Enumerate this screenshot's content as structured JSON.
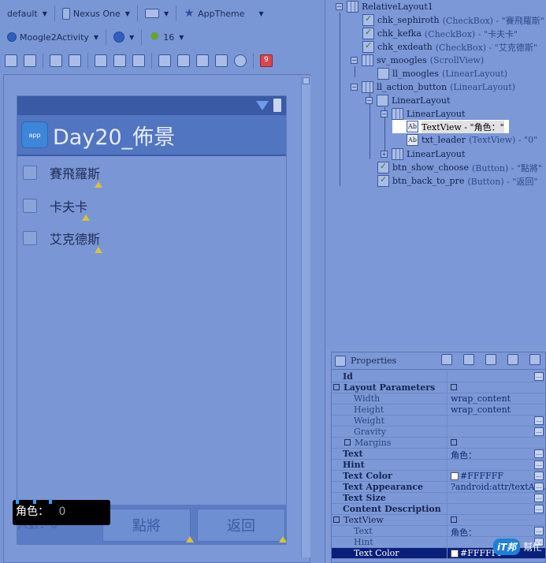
{
  "toolbar1": {
    "config": "default",
    "device": "Nexus One",
    "theme": "AppTheme"
  },
  "toolbar2": {
    "activity": "Moogle2Activity",
    "api_level": "16",
    "badge": "9"
  },
  "device": {
    "app_title": "Day20_佈景",
    "icon_text": "app",
    "checkboxes": [
      {
        "label": "賽飛羅斯"
      },
      {
        "label": "卡夫卡"
      },
      {
        "label": "艾克德斯"
      }
    ],
    "selected_text": "角色：",
    "selected_value": "0",
    "count_label": "人數：0",
    "buttons": {
      "ok": "點將",
      "back": "返回"
    }
  },
  "outline": {
    "nodes": [
      {
        "name": "RelativeLayout1",
        "kind": ""
      },
      {
        "name": "chk_sephiroth",
        "kind": "(CheckBox) - \"賽飛羅斯\""
      },
      {
        "name": "chk_kefka",
        "kind": "(CheckBox) - \"卡夫卡\""
      },
      {
        "name": "chk_exdeath",
        "kind": "(CheckBox) - \"艾克德斯\""
      },
      {
        "name": "sv_moogles",
        "kind": "(ScrollView)"
      },
      {
        "name": "ll_moogles",
        "kind": "(LinearLayout)"
      },
      {
        "name": "ll_action_button",
        "kind": "(LinearLayout)"
      },
      {
        "name": "LinearLayout",
        "kind": ""
      },
      {
        "name": "LinearLayout",
        "kind": ""
      },
      {
        "name": "TextView - \"角色：\"",
        "kind": ""
      },
      {
        "name": "txt_leader",
        "kind": "(TextView) - \"0\""
      },
      {
        "name": "LinearLayout",
        "kind": ""
      },
      {
        "name": "btn_show_choose",
        "kind": "(Button) - \"點將\""
      },
      {
        "name": "btn_back_to_pre",
        "kind": "(Button) - \"返回\""
      }
    ]
  },
  "properties": {
    "title": "Properties",
    "rows": [
      {
        "name": "Id",
        "value": ""
      },
      {
        "name": "Layout Parameters",
        "value": ""
      },
      {
        "name": "Width",
        "value": "wrap_content"
      },
      {
        "name": "Height",
        "value": "wrap_content"
      },
      {
        "name": "Weight",
        "value": ""
      },
      {
        "name": "Gravity",
        "value": ""
      },
      {
        "name": "Margins",
        "value": ""
      },
      {
        "name": "Text",
        "value": "角色："
      },
      {
        "name": "Hint",
        "value": ""
      },
      {
        "name": "Text Color",
        "value": "#FFFFFF"
      },
      {
        "name": "Text Appearance",
        "value": "?android:attr/textAp..."
      },
      {
        "name": "Text Size",
        "value": ""
      },
      {
        "name": "Content Description",
        "value": ""
      },
      {
        "name": "TextView",
        "value": ""
      },
      {
        "name": "Text",
        "value": "角色："
      },
      {
        "name": "Hint",
        "value": ""
      },
      {
        "name": "Text Color",
        "value": "#FFFFFF"
      }
    ]
  },
  "watermark": {
    "logo": "iT邦",
    "text": "幫忙"
  },
  "colors": {
    "accent_selection": "#0a1f7a",
    "actionbar": "#5275c2",
    "warning": "#d8c23c"
  }
}
